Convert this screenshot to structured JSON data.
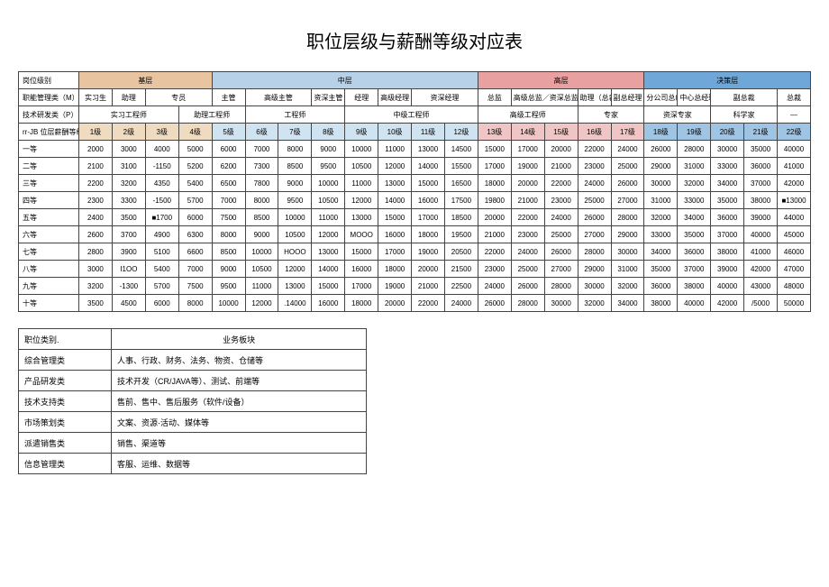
{
  "title": "职位层级与薪酬等级对应表",
  "row_labels": {
    "pos_class": "岗位级别",
    "mgmt": "职能管理类（M）",
    "tech": "技术研发类（P）",
    "salary_hdr": "rr-JB 位层薪酬等级——."
  },
  "tiers": {
    "base": "基层",
    "mid": "中层",
    "high": "高层",
    "dec": "决策层"
  },
  "mgmt_roles": [
    "实习生",
    "助理",
    "专员",
    "主管",
    "高级主管",
    "资深主管",
    "经理",
    "高级经理",
    "资深经理",
    "总监",
    "高级总监／资深总监",
    "助理（总裁）",
    "副总经理",
    "分公司总经理",
    "中心总经理",
    "副总裁",
    "总裁"
  ],
  "tech_roles": [
    "实习工程师",
    "助理工程师",
    "工程师",
    "中级工程师",
    "高级工程师",
    "专家",
    "资深专家",
    "科学家",
    "—"
  ],
  "levels": [
    "1级",
    "2级",
    "3级",
    "4级",
    "5级",
    "6级",
    "7级",
    "8级",
    "9级",
    "10级",
    "11级",
    "12级",
    "13级",
    "14级",
    "15级",
    "16级",
    "17级",
    "18级",
    "19级",
    "20级",
    "21级",
    "22级"
  ],
  "grades": [
    {
      "name": "一等",
      "v": [
        "2000",
        "3000",
        "4000",
        "5000",
        "6000",
        "7000",
        "8000",
        "9000",
        "10000",
        "11000",
        "13000",
        "14500",
        "15000",
        "17000",
        "20000",
        "22000",
        "24000",
        "26000",
        "28000",
        "30000",
        "35000",
        "40000"
      ]
    },
    {
      "name": "二等",
      "v": [
        "2100",
        "3100",
        "-1150",
        "5200",
        "6200",
        "7300",
        "8500",
        "9500",
        "10500",
        "12000",
        "14000",
        "15500",
        "17000",
        "19000",
        "21000",
        "23000",
        "25000",
        "29000",
        "31000",
        "33000",
        "36000",
        "41000"
      ]
    },
    {
      "name": "三等",
      "v": [
        "2200",
        "3200",
        "4350",
        "5400",
        "6500",
        "7800",
        "9000",
        "10000",
        "11000",
        "13000",
        "15000",
        "16500",
        "18000",
        "20000",
        "22000",
        "24000",
        "26000",
        "30000",
        "32000",
        "34000",
        "37000",
        "42000"
      ]
    },
    {
      "name": "四等",
      "v": [
        "2300",
        "3300",
        "-1500",
        "5700",
        "7000",
        "8000",
        "9500",
        "10500",
        "12000",
        "14000",
        "16000",
        "17500",
        "19800",
        "21000",
        "23000",
        "25000",
        "27000",
        "31000",
        "33000",
        "35000",
        "38000",
        "■13000"
      ]
    },
    {
      "name": "五等",
      "v": [
        "2400",
        "3500",
        "■1700",
        "6000",
        "7500",
        "8500",
        "10000",
        "11000",
        "13000",
        "15000",
        "17000",
        "18500",
        "20000",
        "22000",
        "24000",
        "26000",
        "28000",
        "32000",
        "34000",
        "36000",
        "39000",
        "44000"
      ]
    },
    {
      "name": "六等",
      "v": [
        "2600",
        "3700",
        "4900",
        "6300",
        "8000",
        "9000",
        "10500",
        "12000",
        "MOOO",
        "16000",
        "18000",
        "19500",
        "21000",
        "23000",
        "25000",
        "27000",
        "29000",
        "33000",
        "35000",
        "37000",
        "40000",
        "45000"
      ]
    },
    {
      "name": "七等",
      "v": [
        "2800",
        "3900",
        "5100",
        "6600",
        "8500",
        "10000",
        "HOOO",
        "13000",
        "15000",
        "17000",
        "19000",
        "20500",
        "22000",
        "24000",
        "26000",
        "28000",
        "30000",
        "34000",
        "36000",
        "38000",
        "41000",
        "46000"
      ]
    },
    {
      "name": "八等",
      "v": [
        "3000",
        "I1OO",
        "5400",
        "7000",
        "9000",
        "10500",
        "12000",
        "14000",
        "16000",
        "18000",
        "20000",
        "21500",
        "23000",
        "25000",
        "27000",
        "29000",
        "31000",
        "35000",
        "37000",
        "39000",
        "42000",
        "47000"
      ]
    },
    {
      "name": "九等",
      "v": [
        "3200",
        "-1300",
        "5700",
        "7500",
        "9500",
        "11000",
        "13000",
        "15000",
        "17000",
        "19000",
        "21000",
        "22500",
        "24000",
        "26000",
        "28000",
        "30000",
        "32000",
        "36000",
        "38000",
        "40000",
        "43000",
        "48000"
      ]
    },
    {
      "name": "十等",
      "v": [
        "3500",
        "4500",
        "6000",
        "8000",
        "10000",
        "12000",
        ".14000",
        "16000",
        "18000",
        "20000",
        "22000",
        "24000",
        "26000",
        "28000",
        "30000",
        "32000",
        "34000",
        "38000",
        "40000",
        "42000",
        "/5000",
        "50000"
      ]
    }
  ],
  "lower_header": [
    "职位类别.",
    "业务板块"
  ],
  "lower_rows": [
    [
      "综合管理类",
      "人事、行政、财务、法务、物资、仓储等"
    ],
    [
      "产品研发类",
      "技术开发（CR/JAVA等）、测试、前端等"
    ],
    [
      "技术支持类",
      "售前、售中、售后服务（软件/设备）"
    ],
    [
      "市场策划类",
      "文案、资源·活动、媒体等"
    ],
    [
      "派遣销售类",
      "销售、渠道等"
    ],
    [
      "信息管理类",
      "客服、运维、数据等"
    ]
  ]
}
